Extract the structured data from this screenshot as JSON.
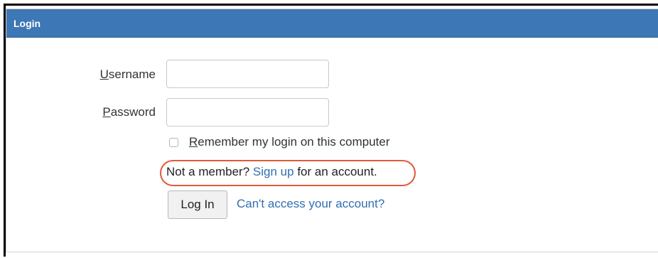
{
  "panel": {
    "title": "Login"
  },
  "form": {
    "username": {
      "label_first": "U",
      "label_rest": "sername",
      "value": ""
    },
    "password": {
      "label_first": "P",
      "label_rest": "assword",
      "value": ""
    },
    "remember": {
      "label_first": "R",
      "label_rest": "emember my login on this computer",
      "checked": false
    },
    "not_member": {
      "prefix": "Not a member?",
      "link": "Sign up",
      "suffix": "for an account."
    },
    "login_button": "Log In",
    "cant_access_link": "Can't access your account?"
  },
  "colors": {
    "header_blue": "#3d77b5",
    "link_blue": "#2f6fb0",
    "highlight_oval": "#e05a3c"
  }
}
